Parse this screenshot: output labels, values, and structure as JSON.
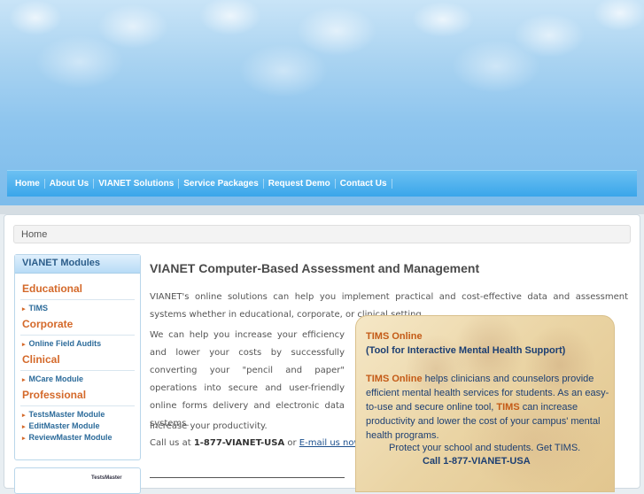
{
  "nav": {
    "items": [
      "Home",
      "About Us",
      "VIANET Solutions",
      "Service Packages",
      "Request Demo",
      "Contact Us"
    ]
  },
  "breadcrumb": "Home",
  "sidebar": {
    "title": "VIANET Modules",
    "sections": [
      {
        "category": "Educational",
        "items": [
          "TIMS"
        ]
      },
      {
        "category": "Corporate",
        "items": [
          "Online Field Audits"
        ]
      },
      {
        "category": "Clinical",
        "items": [
          "MCare Module"
        ]
      },
      {
        "category": "Professional",
        "items": [
          "TestsMaster Module",
          "EditMaster Module",
          "ReviewMaster Module"
        ]
      }
    ],
    "promo_label": "TestsMaster"
  },
  "main": {
    "title": "VIANET Computer-Based Assessment and Management",
    "intro": "VIANET's online solutions can help you implement practical and cost-effective data and assessment systems whether in educational, corporate, or clinical setting.",
    "help": "We can help you increase your efficiency and lower your costs by successfully converting your \"pencil and paper\" operations into secure and user-friendly online forms delivery and electronic data systems.",
    "productivity": "Increase your productivity.",
    "call_prefix": "Call us at",
    "phone": "1-877-VIANET-USA",
    "or": "or",
    "email_link": "E-mail us now."
  },
  "tims": {
    "title": "TIMS Online",
    "subtitle": "(Tool for Interactive Mental Health Support)",
    "body_1_highlight": "TIMS Online",
    "body_1": " helps clinicians and counselors provide efficient mental health services for students. As an easy-to-use and secure online tool, ",
    "body_2_highlight": "TIMS",
    "body_2": " can increase productivity and lower the cost of your campus' mental health programs.",
    "protect": "Protect your school and students. Get TIMS.",
    "call": "Call 1-877-VIANET-USA"
  },
  "colors": {
    "nav_blue": "#3aa6ea",
    "category_orange": "#d4692a",
    "link_blue": "#2c6b9a",
    "tims_navy": "#1d3f72"
  }
}
